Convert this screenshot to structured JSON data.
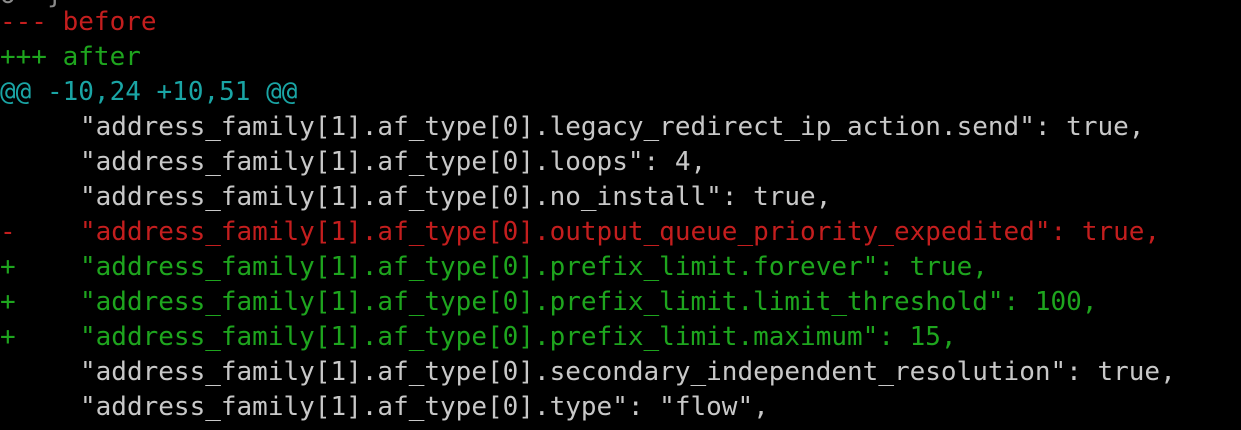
{
  "colors": {
    "background": "#000000",
    "removed": "#c41e1e",
    "added": "#1ea51e",
    "hunk": "#1aa5a5",
    "context": "#c8c8c8"
  },
  "diff": {
    "partial_top_line": "o  }",
    "header_before": "--- before",
    "header_after": "+++ after",
    "hunk_header": "@@ -10,24 +10,51 @@",
    "lines": [
      {
        "marker": " ",
        "text": "\"address_family[1].af_type[0].legacy_redirect_ip_action.send\": true,",
        "kind": "context"
      },
      {
        "marker": " ",
        "text": "\"address_family[1].af_type[0].loops\": 4,",
        "kind": "context"
      },
      {
        "marker": " ",
        "text": "\"address_family[1].af_type[0].no_install\": true,",
        "kind": "context"
      },
      {
        "marker": "-",
        "text": "\"address_family[1].af_type[0].output_queue_priority_expedited\": true,",
        "kind": "removed"
      },
      {
        "marker": "+",
        "text": "\"address_family[1].af_type[0].prefix_limit.forever\": true,",
        "kind": "added"
      },
      {
        "marker": "+",
        "text": "\"address_family[1].af_type[0].prefix_limit.limit_threshold\": 100,",
        "kind": "added"
      },
      {
        "marker": "+",
        "text": "\"address_family[1].af_type[0].prefix_limit.maximum\": 15,",
        "kind": "added"
      },
      {
        "marker": " ",
        "text": "\"address_family[1].af_type[0].secondary_independent_resolution\": true,",
        "kind": "context"
      },
      {
        "marker": " ",
        "text": "\"address_family[1].af_type[0].type\": \"flow\",",
        "kind": "context"
      }
    ]
  }
}
